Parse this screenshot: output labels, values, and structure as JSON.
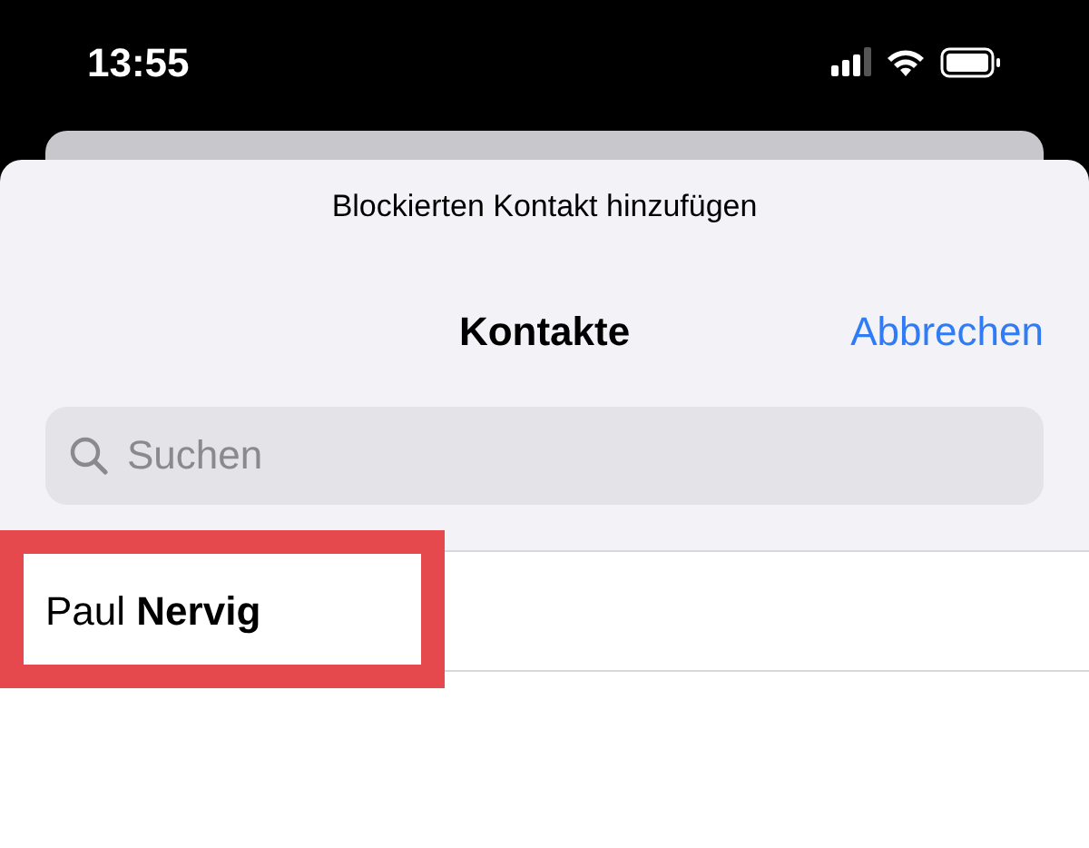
{
  "status_bar": {
    "time": "13:55"
  },
  "sheet": {
    "title": "Blockierten Kontakt hinzufügen"
  },
  "nav": {
    "title": "Kontakte",
    "cancel": "Abbrechen"
  },
  "search": {
    "placeholder": "Suchen"
  },
  "contacts": [
    {
      "name": "Paul **Nervig**",
      "highlighted": true
    }
  ]
}
